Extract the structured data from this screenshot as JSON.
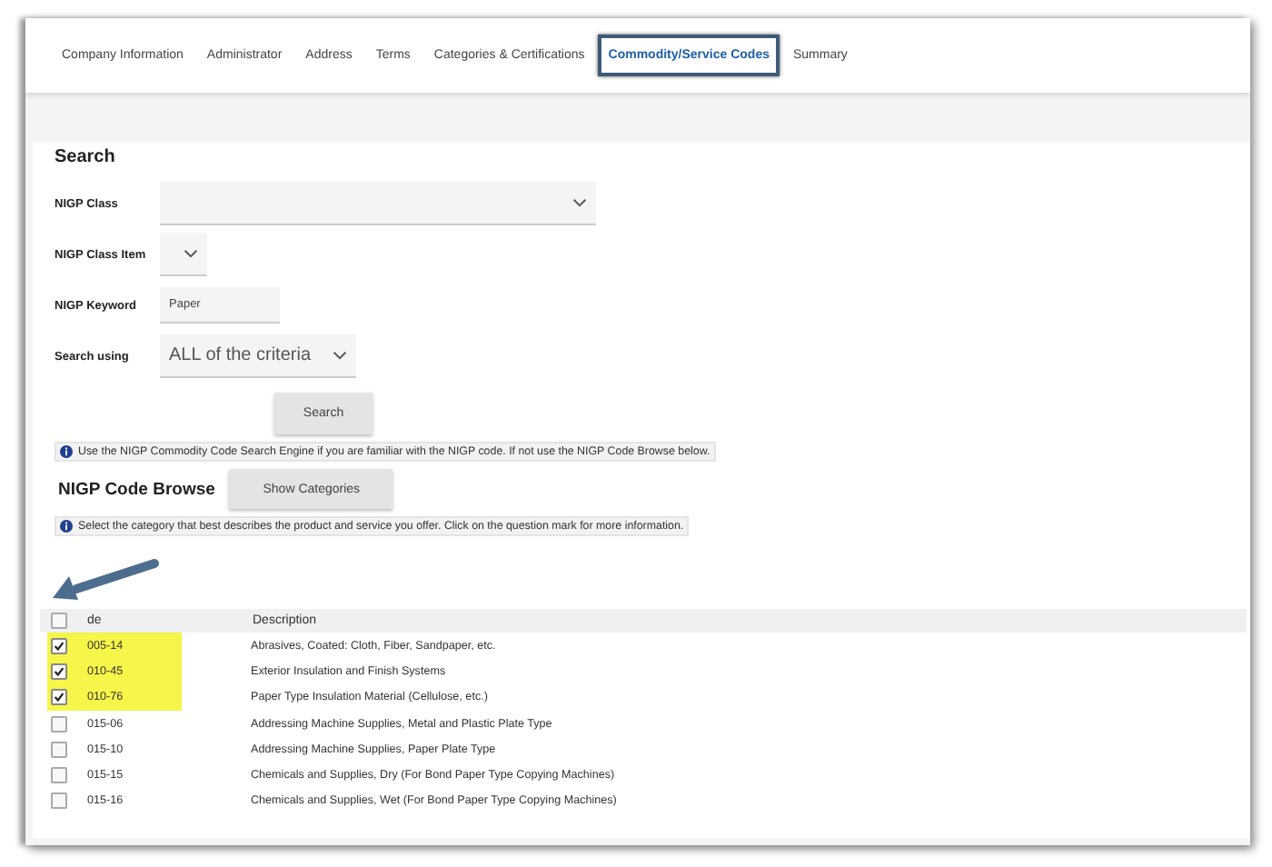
{
  "tabs": [
    {
      "label": "Company Information",
      "selected": false
    },
    {
      "label": "Administrator",
      "selected": false
    },
    {
      "label": "Address",
      "selected": false
    },
    {
      "label": "Terms",
      "selected": false
    },
    {
      "label": "Categories & Certifications",
      "selected": false
    },
    {
      "label": "Commodity/Service Codes",
      "selected": true
    },
    {
      "label": "Summary",
      "selected": false
    }
  ],
  "search": {
    "title": "Search",
    "fields": [
      {
        "kind": "select",
        "label": "NIGP Class"
      },
      {
        "kind": "select",
        "label": "NIGP Class Item"
      },
      {
        "kind": "text",
        "label": "NIGP Keyword",
        "value": "Paper"
      },
      {
        "kind": "select",
        "label": "Search using",
        "value": "ALL of the criteria"
      }
    ],
    "button": "Search",
    "info": "Use the NIGP Commodity Code Search Engine if you are familiar with the NIGP code. If not use the NIGP Code Browse below."
  },
  "browse": {
    "title": "NIGP Code Browse",
    "button": "Show Categories",
    "info": "Select the category that best describes the product and service you offer. Click on the question mark for more information."
  },
  "table": {
    "select_all": {
      "checked": false
    },
    "columns": [
      "de",
      "Description"
    ],
    "rows": [
      {
        "checked": true,
        "code": "005-14",
        "description": "Abrasives, Coated: Cloth, Fiber, Sandpaper, etc."
      },
      {
        "checked": true,
        "code": "010-45",
        "description": "Exterior Insulation and Finish Systems"
      },
      {
        "checked": true,
        "code": "010-76",
        "description": "Paper Type Insulation Material (Cellulose, etc.)"
      },
      {
        "checked": false,
        "code": "015-06",
        "description": "Addressing Machine Supplies, Metal and Plastic Plate Type"
      },
      {
        "checked": false,
        "code": "015-10",
        "description": "Addressing Machine Supplies, Paper Plate Type"
      },
      {
        "checked": false,
        "code": "015-15",
        "description": "Chemicals and Supplies, Dry (For Bond Paper Type Copying Machines)"
      },
      {
        "checked": false,
        "code": "015-16",
        "description": "Chemicals and Supplies, Wet (For Bond Paper Type Copying Machines)"
      }
    ]
  }
}
